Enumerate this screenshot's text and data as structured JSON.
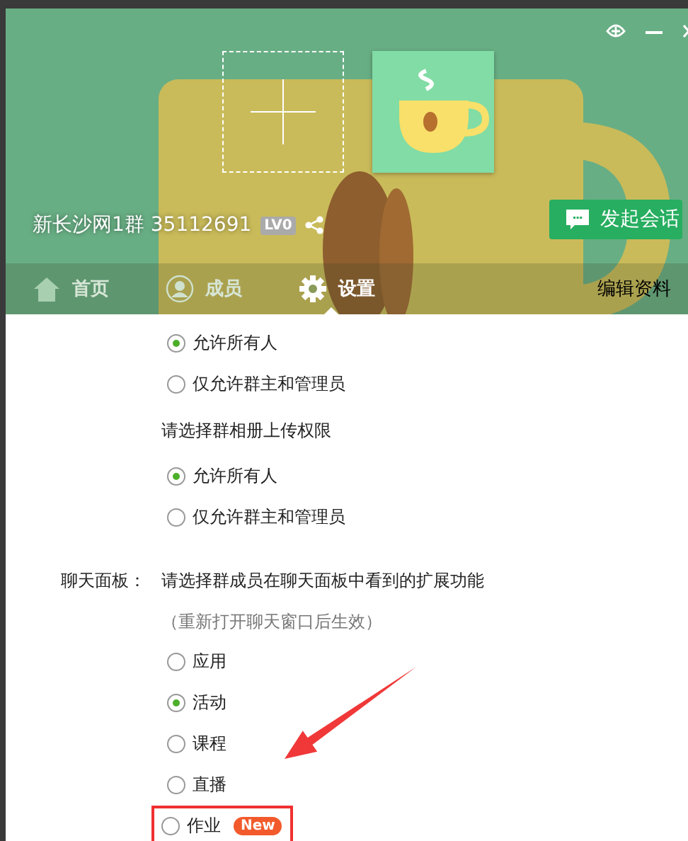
{
  "header": {
    "group_name": "新长沙网1群",
    "group_number": "35112691",
    "level_badge": "LV0",
    "start_chat_button": "发起会话"
  },
  "tabs": [
    {
      "label": "首页",
      "selected": false
    },
    {
      "label": "成员",
      "selected": false
    },
    {
      "label": "设置",
      "selected": true
    }
  ],
  "edit_profile_link": "编辑资料",
  "settings": [
    {
      "kind": "radio",
      "text": "允许所有人",
      "selected": true
    },
    {
      "kind": "radio",
      "text": "仅允许群主和管理员",
      "selected": false
    },
    {
      "kind": "prompt",
      "text": "请选择群相册上传权限"
    },
    {
      "kind": "radio",
      "text": "允许所有人",
      "selected": true
    },
    {
      "kind": "radio",
      "text": "仅允许群主和管理员",
      "selected": false
    },
    {
      "kind": "section",
      "label": "聊天面板：",
      "text": "请选择群成员在聊天面板中看到的扩展功能"
    },
    {
      "kind": "note",
      "text": "（重新打开聊天窗口后生效）"
    },
    {
      "kind": "radio",
      "text": "应用",
      "selected": false
    },
    {
      "kind": "radio",
      "text": "活动",
      "selected": true
    },
    {
      "kind": "radio",
      "text": "课程",
      "selected": false
    },
    {
      "kind": "radio",
      "text": "直播",
      "selected": false
    },
    {
      "kind": "radio",
      "text": "作业",
      "selected": false,
      "badge": "New",
      "highlighted": true
    }
  ]
}
